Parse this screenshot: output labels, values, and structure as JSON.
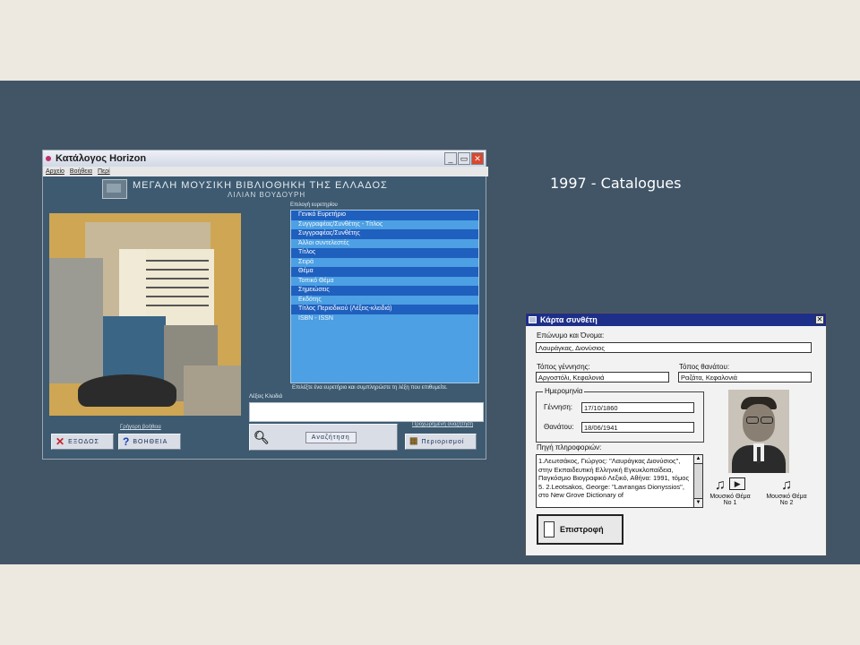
{
  "slide": {
    "caption": "1997 - Catalogues"
  },
  "horizon": {
    "title": "Κατάλογος Horizon",
    "window_buttons": [
      "_",
      "▭",
      "✕"
    ],
    "menu": [
      "Αρχείο",
      "Βοήθεια",
      "Περί"
    ],
    "header_line1": "ΜΕΓΑΛΗ ΜΟΥΣΙΚΗ ΒΙΒΛΙΟΘΗΚΗ ΤΗΣ ΕΛΛΑΔΟΣ",
    "header_line2": "ΛΙΛΙΑΝ ΒΟΥΔΟΥΡΗ",
    "index_label": "Επιλογή ευρετηρίου",
    "indexes": [
      {
        "label": "Γενικό Ευρετήριο",
        "selected": true
      },
      {
        "label": "Συγγραφέας/Συνθέτης - Τίτλος",
        "selected": false
      },
      {
        "label": "Συγγραφέας/Συνθέτης",
        "selected": true
      },
      {
        "label": "Άλλοι συντελεστές",
        "selected": false
      },
      {
        "label": "Τίτλος",
        "selected": true
      },
      {
        "label": "Σειρά",
        "selected": false
      },
      {
        "label": "Θέμα",
        "selected": true
      },
      {
        "label": "Τοπικό Θέμα",
        "selected": false
      },
      {
        "label": "Σημειώσεις",
        "selected": true
      },
      {
        "label": "Εκδότης",
        "selected": false
      },
      {
        "label": "Τίτλος Περιοδικού (Λέξεις-κλειδιά)",
        "selected": true
      },
      {
        "label": "ISBN - ISSN",
        "selected": false
      }
    ],
    "instruction": "Επιλέξτε ένα ευρετήριο και συμπληρώστε τη λέξη που επιθυμείτε.",
    "keyword_label": "Λέξεις Κλειδιά",
    "keyword_value": "",
    "help_link": "Γρήγορη βοήθεια",
    "advanced_link": "Προχωρημένη αναζήτηση",
    "exit_label": "ΕΞΟΔΟΣ",
    "help_label": "ΒΟΗΘΕΙΑ",
    "search_label": "Αναζήτηση",
    "limits_label": "Περιορισμοί",
    "colors": {
      "list_bg": "#4ca0e3",
      "list_selected": "#1f5fbe",
      "window_bg": "#3d5a70"
    }
  },
  "composer": {
    "title": "Κάρτα συνθέτη",
    "close_glyph": "✕",
    "name_label": "Επώνυμο και Όνομα:",
    "name_value": "Λαυράγκας, Διονύσιος",
    "birthplace_label": "Τόπος γέννησης:",
    "birthplace_value": "Αργοστόλι, Κεφαλονιά",
    "deathplace_label": "Τόπος θανάτου:",
    "deathplace_value": "Ραζάτα, Κεφαλονιά",
    "dates_label": "Ημερομηνία",
    "birth_label": "Γέννηση:",
    "birth_value": "17/10/1860",
    "death_label": "Θανάτου:",
    "death_value": "18/06/1941",
    "source_label": "Πηγή πληροφοριών:",
    "source_text": "1.Λεωτσάκος, Γιώργος: \"Λαυράγκας Διονύσιος\", στην Εκπαιδευτική Ελληνική Εγκυκλοπαίδεια, Παγκόσμιο Βιογραφικό Λεξικό, Αθήνα: 1991, τόμος 5. 2.Leotsakos, George: \"Lavrangas Dionyssios\", στο New Grove Dictionary of",
    "music1_label": "Μουσικό Θέμα Νο 1",
    "music2_label": "Μουσικό Θέμα Νο 2",
    "back_label": "Επιστροφή"
  }
}
